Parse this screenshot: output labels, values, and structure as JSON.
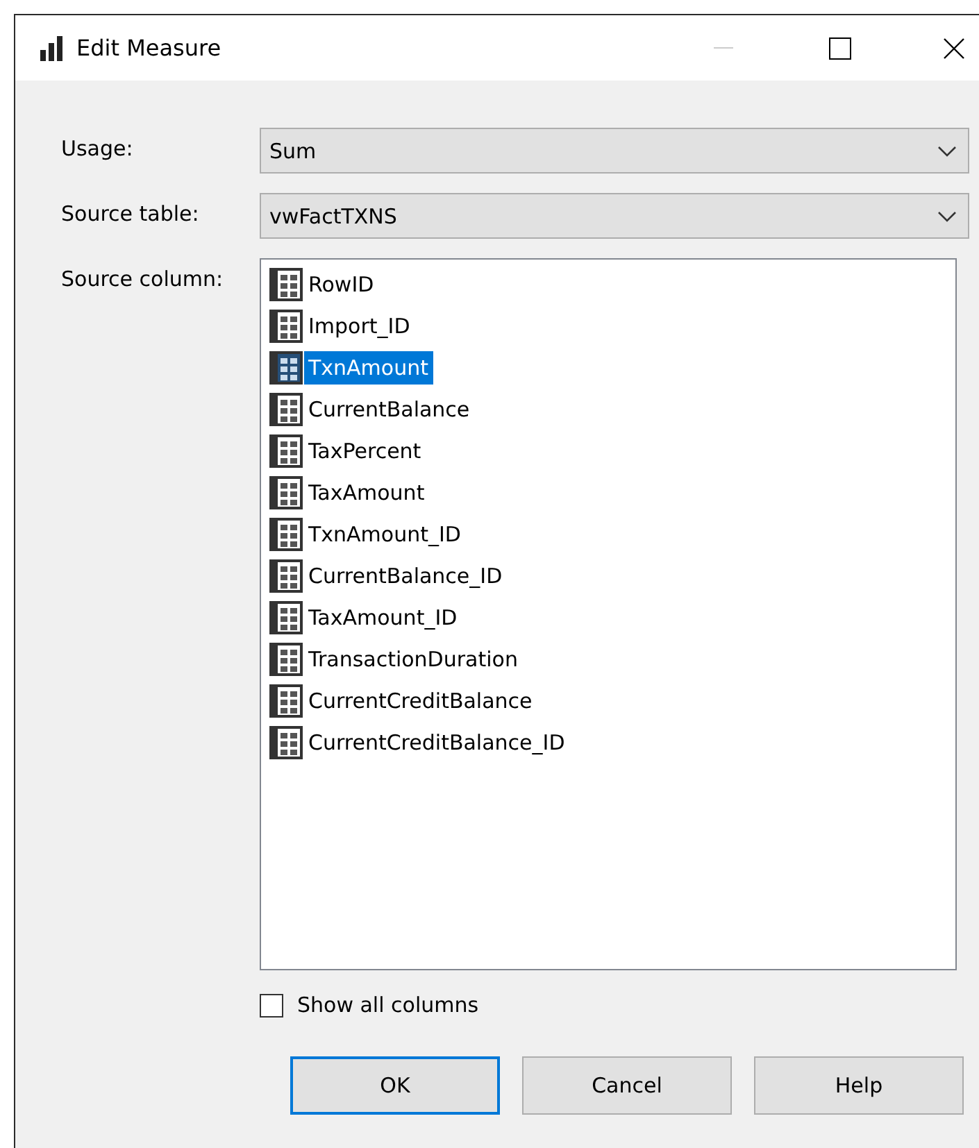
{
  "window": {
    "title": "Edit Measure"
  },
  "usage": {
    "label": "Usage:",
    "value": "Sum"
  },
  "source_table": {
    "label": "Source table:",
    "value": "vwFactTXNS"
  },
  "source_column": {
    "label": "Source column:",
    "items": [
      {
        "name": "RowID",
        "selected": false
      },
      {
        "name": "Import_ID",
        "selected": false
      },
      {
        "name": "TxnAmount",
        "selected": true
      },
      {
        "name": "CurrentBalance",
        "selected": false
      },
      {
        "name": "TaxPercent",
        "selected": false
      },
      {
        "name": "TaxAmount",
        "selected": false
      },
      {
        "name": "TxnAmount_ID",
        "selected": false
      },
      {
        "name": "CurrentBalance_ID",
        "selected": false
      },
      {
        "name": "TaxAmount_ID",
        "selected": false
      },
      {
        "name": "TransactionDuration",
        "selected": false
      },
      {
        "name": "CurrentCreditBalance",
        "selected": false
      },
      {
        "name": "CurrentCreditBalance_ID",
        "selected": false
      }
    ]
  },
  "show_all_columns": {
    "label": "Show all columns",
    "checked": false
  },
  "buttons": [
    {
      "label": "OK",
      "default": true
    },
    {
      "label": "Cancel",
      "default": false
    },
    {
      "label": "Help",
      "default": false
    }
  ]
}
